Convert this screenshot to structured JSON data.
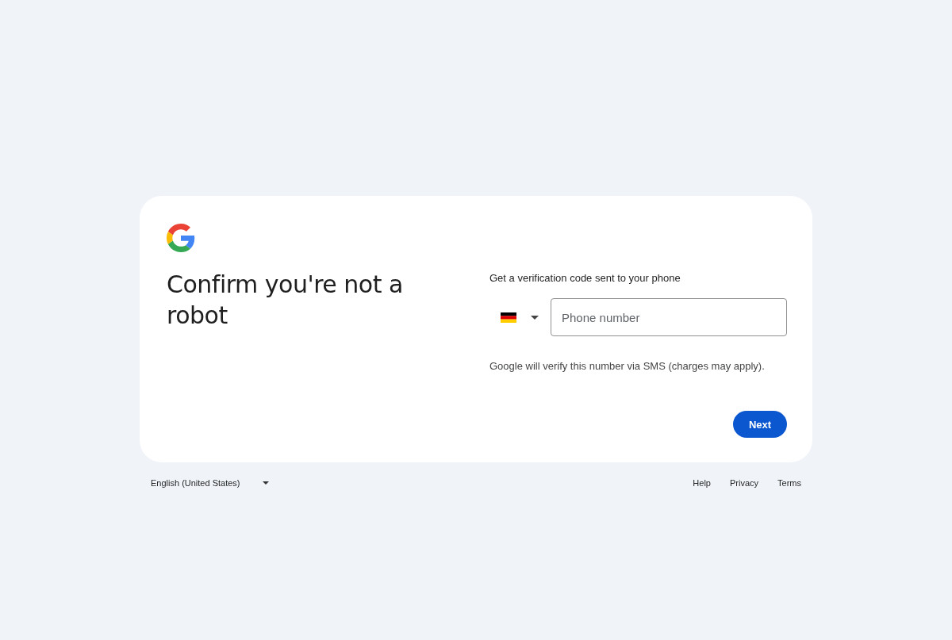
{
  "card": {
    "heading": "Confirm you're not a robot",
    "prompt": "Get a verification code sent to your phone",
    "phone_field": {
      "placeholder": "Phone number"
    },
    "helper_text": "Google will verify this number via SMS (charges may apply).",
    "buttons": [
      "Next"
    ]
  },
  "footer": {
    "language": "English (United States)",
    "links": [
      "Help",
      "Privacy",
      "Terms"
    ]
  }
}
